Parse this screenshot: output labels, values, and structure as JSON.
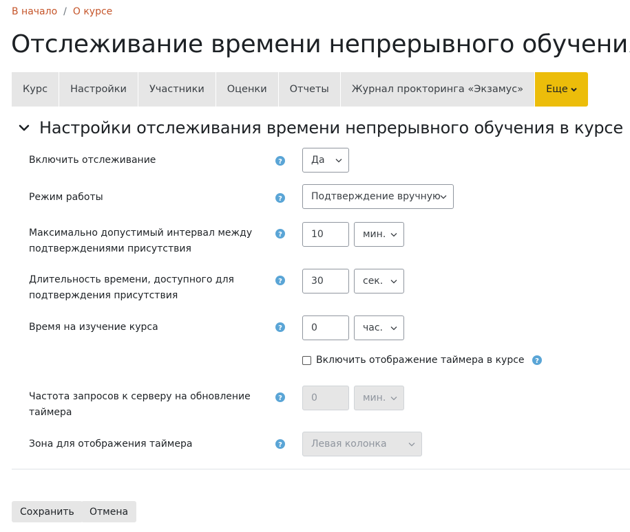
{
  "breadcrumb": {
    "home": "В начало",
    "current": "О курсе",
    "separator": "/"
  },
  "page_title": "Отслеживание времени непрерывного обучения",
  "tabs": [
    {
      "label": "Курс"
    },
    {
      "label": "Настройки"
    },
    {
      "label": "Участники"
    },
    {
      "label": "Оценки"
    },
    {
      "label": "Отчеты"
    },
    {
      "label": "Журнал прокторинга «Экзамус»"
    }
  ],
  "more_tab": {
    "label": "Еще",
    "icon": "chevron-down-icon",
    "color": "#ecbd0a"
  },
  "section": {
    "title": "Настройки отслеживания времени непрерывного обучения в курсе",
    "icon": "chevron-down-icon"
  },
  "fields": {
    "tracking": {
      "label": "Включить отслеживание",
      "value": "Да"
    },
    "mode": {
      "label": "Режим работы",
      "value": "Подтверждение вручную"
    },
    "max_interval": {
      "label": "Максимально допустимый интервал между подтверждениями присутствия",
      "value": "10",
      "unit": "мин."
    },
    "duration": {
      "label": "Длительность времени, доступного для подтверждения присутствия",
      "value": "30",
      "unit": "сек."
    },
    "study_time": {
      "label": "Время на изучение курса",
      "value": "0",
      "unit": "час."
    },
    "timer_checkbox": {
      "label": "Включить отображение таймера в курсе",
      "checked": false
    },
    "request_freq": {
      "label": "Частота запросов к серверу на обновление таймера",
      "value": "0",
      "unit": "мин."
    },
    "timer_zone": {
      "label": "Зона для отображения таймера",
      "value": "Левая колонка"
    }
  },
  "buttons": {
    "save": "Сохранить",
    "cancel": "Отмена"
  },
  "colors": {
    "link": "#c5552a",
    "help_icon": "#5aa5d6",
    "accent": "#ecbd0a"
  }
}
